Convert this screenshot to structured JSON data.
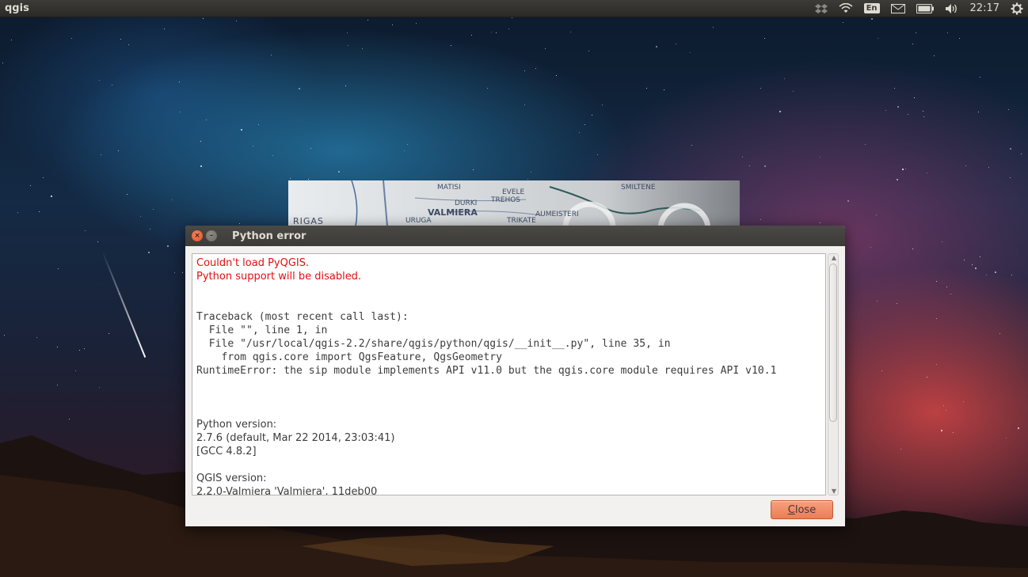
{
  "top_panel": {
    "app_name": "qgis",
    "keyboard_layout": "En",
    "clock": "22:17",
    "icons": [
      "dropbox-icon",
      "wifi-icon",
      "keyboard-icon",
      "mail-icon",
      "battery-icon",
      "volume-icon",
      "gear-icon"
    ]
  },
  "splash": {
    "map_labels": [
      "RIGAS",
      "VALMIERA",
      "MATISI",
      "EVELE",
      "TREHOS",
      "AUMEISTERI",
      "TRIKATE",
      "URUGA",
      "DURKI",
      "SMILTENE"
    ]
  },
  "dialog": {
    "title": "Python error",
    "error_lines": [
      "Couldn't load PyQGIS.",
      "Python support will be disabled."
    ],
    "traceback_lines": [
      "Traceback (most recent call last):",
      "  File \"\", line 1, in",
      "  File \"/usr/local/qgis-2.2/share/qgis/python/qgis/__init__.py\", line 35, in",
      "    from qgis.core import QgsFeature, QgsGeometry",
      "RuntimeError: the sip module implements API v11.0 but the qgis.core module requires API v10.1"
    ],
    "python_version_label": "Python version:",
    "python_version_lines": [
      "2.7.6 (default, Mar 22 2014, 23:03:41)",
      "[GCC 4.8.2]"
    ],
    "qgis_version_label": "QGIS version:",
    "qgis_version_line": "2.2.0-Valmiera 'Valmiera', 11deb00",
    "close_button_access_key": "C",
    "close_button_rest": "lose"
  }
}
